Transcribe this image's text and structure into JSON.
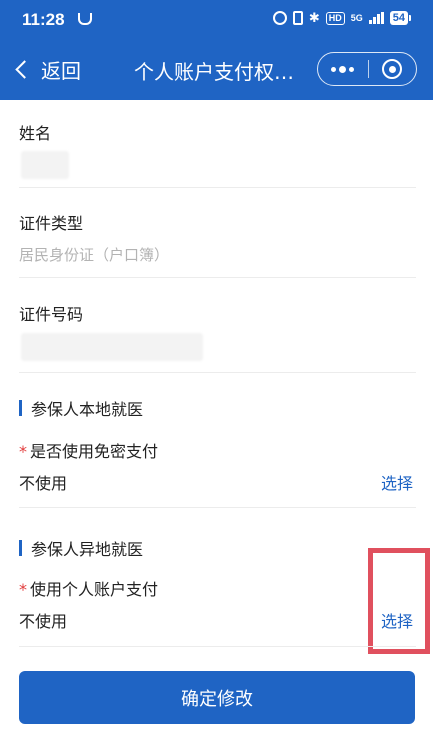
{
  "status_bar": {
    "time": "11:28",
    "network": "5G",
    "hd": "HD",
    "battery": "54"
  },
  "navbar": {
    "back_label": "返回",
    "title": "个人账户支付权…"
  },
  "form": {
    "name": {
      "label": "姓名"
    },
    "id_type": {
      "label": "证件类型",
      "value": "居民身份证（户口簿）"
    },
    "id_number": {
      "label": "证件号码"
    }
  },
  "local_section": {
    "title": "参保人本地就医",
    "item_label": "是否使用免密支付",
    "value": "不使用",
    "action": "选择"
  },
  "remote_section": {
    "title": "参保人异地就医",
    "item_label": "使用个人账户支付",
    "value": "不使用",
    "action": "选择"
  },
  "required_mark": "*",
  "confirm_label": "确定修改",
  "colors": {
    "primary": "#1f64c4",
    "highlight": "#e0505e",
    "required": "#e23b3b"
  }
}
